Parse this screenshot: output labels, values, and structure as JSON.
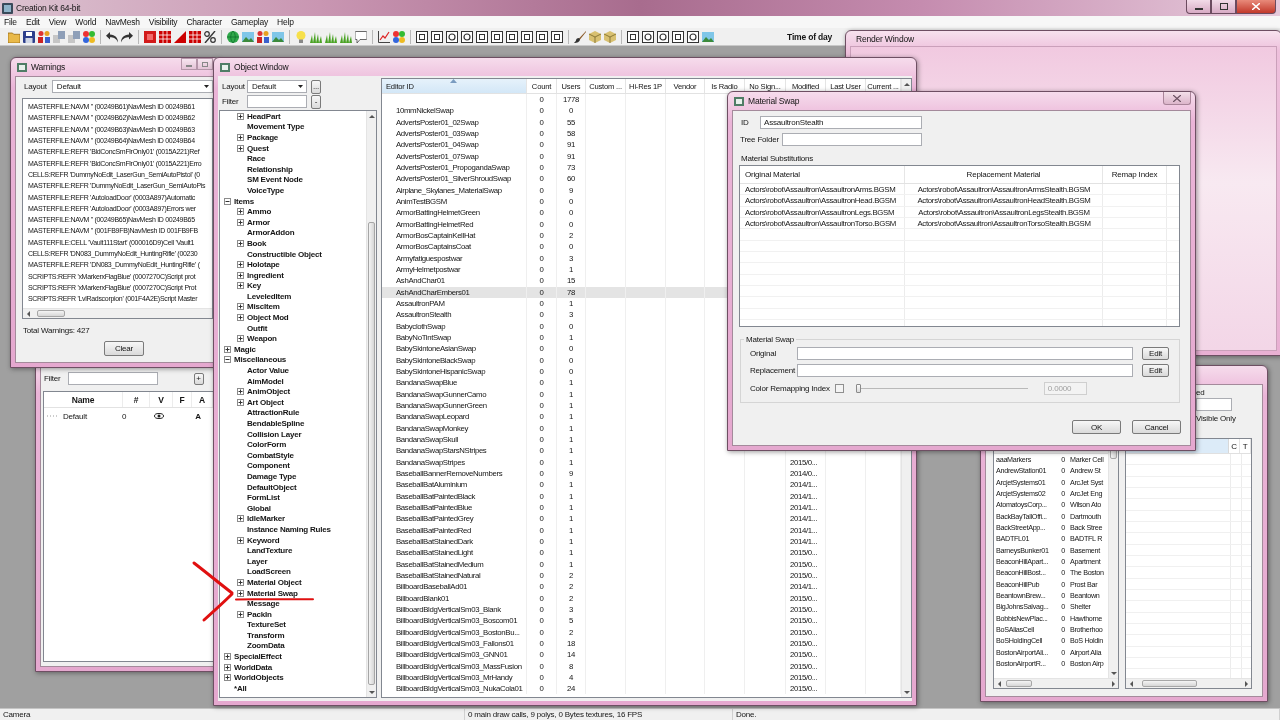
{
  "app": {
    "title": "Creation Kit 64-bit"
  },
  "menu": [
    "File",
    "Edit",
    "View",
    "World",
    "NavMesh",
    "Visibility",
    "Character",
    "Gameplay",
    "Help"
  ],
  "toolbar": {
    "time_of_day_label": "Time of day"
  },
  "render_window": {
    "title": "Render Window"
  },
  "warnings_window": {
    "title": "Warnings",
    "layout_label": "Layout",
    "layout_value": "Default",
    "lines": [
      "MASTERFILE:NAVM '' (00249B61)NavMesh ID 00249B61",
      "MASTERFILE:NAVM '' (00249B62)NavMesh ID 00249B62",
      "MASTERFILE:NAVM '' (00249B63)NavMesh ID 00249B63",
      "MASTERFILE:NAVM '' (00249B64)NavMesh ID 00249B64",
      "MASTERFILE:REFR 'BldConcSmFlrOnly01' (0015A221)Ref",
      "MASTERFILE:REFR 'BldConcSmFlrOnly01' (0015A221)Erro",
      "CELLS:REFR 'DummyNoEdit_LaserGun_SemiAutoPistol' (0",
      "MASTERFILE:REFR 'DummyNoEdit_LaserGun_SemiAutoPis",
      "MASTERFILE:REFR 'AutoloadDoor' (0003A897)Automatic",
      "MASTERFILE:REFR 'AutoloadDoor' (0003A897)Errors wer",
      "MASTERFILE:NAVM '' (00249B65)NavMesh ID 00249B65",
      "MASTERFILE:NAVM '' (001FB9FB)NavMesh ID 001FB9FB",
      "MASTERFILE:CELL 'Vault111Start' (000016D9)Cell 'Vault1",
      "CELLS:REFR 'DN083_DummyNoEdit_HuntingRifle' (00230",
      "MASTERFILE:REFR 'DN083_DummyNoEdit_HuntingRifle' (",
      "SCRIPTS:REFR 'xMarkerxFlagBlue' (0007270C)Script prot",
      "SCRIPTS:REFR 'xMarkerxFlagBlue' (0007270C)Script Prot",
      "SCRIPTS:REFR 'LvlRadscorpion' (001F4A2E)Script Master"
    ],
    "total": "Total Warnings: 427",
    "clear_button": "Clear"
  },
  "layer_window": {
    "filter_label": "Filter",
    "add_button": "+",
    "columns": [
      "Name",
      "#",
      "V",
      "F",
      "A"
    ],
    "rows": [
      {
        "name": "Default",
        "count": "0",
        "visible": true,
        "active_flag": "A"
      }
    ]
  },
  "object_window": {
    "title": "Object Window",
    "layout_label": "Layout",
    "layout_value": "Default",
    "layout_more_button": "...",
    "filter_label": "Filter",
    "filter_button": "-",
    "tree": [
      {
        "children": [
          {
            "label": "HeadPart",
            "expanded": false
          },
          {
            "label": "Movement Type"
          },
          {
            "label": "Package",
            "expanded": false
          },
          {
            "label": "Quest",
            "expanded": false
          },
          {
            "label": "Race"
          },
          {
            "label": "Relationship"
          },
          {
            "label": "SM Event Node"
          },
          {
            "label": "VoiceType"
          }
        ]
      },
      {
        "label": "Items",
        "expanded": true,
        "children": [
          {
            "label": "Ammo",
            "expanded": false
          },
          {
            "label": "Armor",
            "expanded": false
          },
          {
            "label": "ArmorAddon"
          },
          {
            "label": "Book",
            "expanded": false
          },
          {
            "label": "Constructible Object"
          },
          {
            "label": "Holotape",
            "expanded": false
          },
          {
            "label": "Ingredient",
            "expanded": false
          },
          {
            "label": "Key",
            "expanded": false
          },
          {
            "label": "LeveledItem"
          },
          {
            "label": "MiscItem",
            "expanded": false
          },
          {
            "label": "Object Mod",
            "expanded": false
          },
          {
            "label": "Outfit"
          },
          {
            "label": "Weapon",
            "expanded": false
          }
        ]
      },
      {
        "label": "Magic",
        "expanded": false
      },
      {
        "label": "Miscellaneous",
        "expanded": true,
        "children": [
          {
            "label": "Actor Value"
          },
          {
            "label": "AimModel"
          },
          {
            "label": "AnimObject",
            "expanded": false
          },
          {
            "label": "Art Object",
            "expanded": false
          },
          {
            "label": "AttractionRule"
          },
          {
            "label": "BendableSpline"
          },
          {
            "label": "Collision Layer"
          },
          {
            "label": "ColorForm"
          },
          {
            "label": "CombatStyle"
          },
          {
            "label": "Component"
          },
          {
            "label": "Damage Type"
          },
          {
            "label": "DefaultObject"
          },
          {
            "label": "FormList"
          },
          {
            "label": "Global"
          },
          {
            "label": "IdleMarker",
            "expanded": false
          },
          {
            "label": "Instance Naming Rules"
          },
          {
            "label": "Keyword",
            "expanded": false
          },
          {
            "label": "LandTexture"
          },
          {
            "label": "Layer"
          },
          {
            "label": "LoadScreen"
          },
          {
            "label": "Material Object",
            "expanded": false
          },
          {
            "label": "Material Swap",
            "expanded": false
          },
          {
            "label": "Message"
          },
          {
            "label": "PackIn",
            "expanded": false
          },
          {
            "label": "TextureSet"
          },
          {
            "label": "Transform"
          },
          {
            "label": "ZoomData"
          }
        ]
      },
      {
        "label": "SpecialEffect",
        "expanded": false
      },
      {
        "label": "WorldData",
        "expanded": false
      },
      {
        "label": "WorldObjects",
        "expanded": false
      },
      {
        "label": "*All"
      }
    ],
    "columns": [
      "Editor ID",
      "Count",
      "Users",
      "Custom ...",
      "Hi-Res 1P",
      "Vendor",
      "Is Radio",
      "No Sign...",
      "Modified",
      "Last User",
      "Current ..."
    ],
    "rows": [
      {
        "count": "0",
        "users": "1778",
        "selected": false
      },
      {
        "editor_id": "10mmNickelSwap",
        "count": "0",
        "users": "0",
        "selected": false
      },
      {
        "editor_id": "AdvertsPoster01_02Swap",
        "count": "0",
        "users": "55",
        "selected": false
      },
      {
        "editor_id": "AdvertsPoster01_03Swap",
        "count": "0",
        "users": "58",
        "selected": false
      },
      {
        "editor_id": "AdvertsPoster01_04Swap",
        "count": "0",
        "users": "91",
        "selected": false
      },
      {
        "editor_id": "AdvertsPoster01_07Swap",
        "count": "0",
        "users": "91",
        "selected": false
      },
      {
        "editor_id": "AdvertsPoster01_PropogandaSwap",
        "count": "0",
        "users": "73",
        "selected": false
      },
      {
        "editor_id": "AdvertsPoster01_SilverShroudSwap",
        "count": "0",
        "users": "60",
        "selected": false
      },
      {
        "editor_id": "Airplane_Skylanes_MaterialSwap",
        "count": "0",
        "users": "9",
        "selected": false
      },
      {
        "editor_id": "AnimTestBGSM",
        "count": "0",
        "users": "0",
        "selected": false
      },
      {
        "editor_id": "ArmorBattingHelmetGreen",
        "count": "0",
        "users": "0",
        "selected": false
      },
      {
        "editor_id": "ArmorBattingHelmetRed",
        "count": "0",
        "users": "0",
        "selected": false
      },
      {
        "editor_id": "ArmorBosCaptainKellHat",
        "count": "0",
        "users": "2",
        "selected": false
      },
      {
        "editor_id": "ArmorBosCaptainsCoat",
        "count": "0",
        "users": "0",
        "selected": false
      },
      {
        "editor_id": "Armyfatiguespostwar",
        "count": "0",
        "users": "3",
        "selected": false
      },
      {
        "editor_id": "ArmyHelmetpostwar",
        "count": "0",
        "users": "1",
        "selected": false
      },
      {
        "editor_id": "AshAndChar01",
        "count": "0",
        "users": "15",
        "selected": false
      },
      {
        "editor_id": "AshAndCharEmbers01",
        "count": "0",
        "users": "78",
        "selected": true
      },
      {
        "editor_id": "AssaultronPAM",
        "count": "0",
        "users": "1",
        "selected": false
      },
      {
        "editor_id": "AssaultronStealth",
        "count": "0",
        "users": "3",
        "selected": false
      },
      {
        "editor_id": "BabyclothSwap",
        "count": "0",
        "users": "0",
        "selected": false
      },
      {
        "editor_id": "BabyNoTintSwap",
        "count": "0",
        "users": "1",
        "selected": false
      },
      {
        "editor_id": "BabySkintoneAsianSwap",
        "count": "0",
        "users": "0",
        "selected": false
      },
      {
        "editor_id": "BabySkintoneBlackSwap",
        "count": "0",
        "users": "0",
        "selected": false
      },
      {
        "editor_id": "BabySkintoneHispanicSwap",
        "count": "0",
        "users": "0",
        "selected": false
      },
      {
        "editor_id": "BandanaSwapBlue",
        "count": "0",
        "users": "1",
        "selected": false
      },
      {
        "editor_id": "BandanaSwapGunnerCamo",
        "count": "0",
        "users": "1",
        "selected": false
      },
      {
        "editor_id": "BandanaSwapGunnerGreen",
        "count": "0",
        "users": "1",
        "selected": false
      },
      {
        "editor_id": "BandanaSwapLeopard",
        "count": "0",
        "users": "1",
        "selected": false
      },
      {
        "editor_id": "BandanaSwapMonkey",
        "count": "0",
        "users": "1",
        "selected": false
      },
      {
        "editor_id": "BandanaSwapSkull",
        "count": "0",
        "users": "1",
        "selected": false
      },
      {
        "editor_id": "BandanaSwapStarsNStripes",
        "count": "0",
        "users": "1",
        "selected": false
      },
      {
        "editor_id": "BandanaSwapStripes",
        "count": "0",
        "users": "1",
        "modified": "2015/0...",
        "selected": false
      },
      {
        "editor_id": "BaseballBannerRemoveNumbers",
        "count": "0",
        "users": "9",
        "modified": "2014/0...",
        "selected": false
      },
      {
        "editor_id": "BaseballBatAluminium",
        "count": "0",
        "users": "1",
        "modified": "2014/1...",
        "selected": false
      },
      {
        "editor_id": "BaseballBatPaintedBlack",
        "count": "0",
        "users": "1",
        "modified": "2014/1...",
        "selected": false
      },
      {
        "editor_id": "BaseballBatPaintedBlue",
        "count": "0",
        "users": "1",
        "modified": "2014/1...",
        "selected": false
      },
      {
        "editor_id": "BaseballBatPaintedGrey",
        "count": "0",
        "users": "1",
        "modified": "2014/1...",
        "selected": false
      },
      {
        "editor_id": "BaseballBatPaintedRed",
        "count": "0",
        "users": "1",
        "modified": "2014/1...",
        "selected": false
      },
      {
        "editor_id": "BaseballBatStainedDark",
        "count": "0",
        "users": "1",
        "modified": "2014/1...",
        "selected": false
      },
      {
        "editor_id": "BaseballBatStainedLight",
        "count": "0",
        "users": "1",
        "modified": "2015/0...",
        "selected": false
      },
      {
        "editor_id": "BaseballBatStainedMedium",
        "count": "0",
        "users": "1",
        "modified": "2015/0...",
        "selected": false
      },
      {
        "editor_id": "BaseballBatStainedNatural",
        "count": "0",
        "users": "2",
        "modified": "2015/0...",
        "selected": false
      },
      {
        "editor_id": "BillboardBaseballAd01",
        "count": "0",
        "users": "2",
        "modified": "2014/1...",
        "selected": false
      },
      {
        "editor_id": "BillboardBlank01",
        "count": "0",
        "users": "2",
        "modified": "2015/0...",
        "selected": false
      },
      {
        "editor_id": "BillboardBldgVerticalSm03_Blank",
        "count": "0",
        "users": "3",
        "modified": "2015/0...",
        "selected": false
      },
      {
        "editor_id": "BillboardBldgVerticalSm03_Boscom01",
        "count": "0",
        "users": "5",
        "modified": "2015/0...",
        "selected": false
      },
      {
        "editor_id": "BillboardBldgVerticalSm03_BostonBu...",
        "count": "0",
        "users": "2",
        "modified": "2015/0...",
        "selected": false
      },
      {
        "editor_id": "BillboardBldgVerticalSm03_Fallons01",
        "count": "0",
        "users": "18",
        "modified": "2015/0...",
        "selected": false
      },
      {
        "editor_id": "BillboardBldgVerticalSm03_GNN01",
        "count": "0",
        "users": "14",
        "modified": "2015/0...",
        "selected": false
      },
      {
        "editor_id": "BillboardBldgVerticalSm03_MassFusion",
        "count": "0",
        "users": "8",
        "modified": "2015/0...",
        "selected": false
      },
      {
        "editor_id": "BillboardBldgVerticalSm03_MrHandy",
        "count": "0",
        "users": "4",
        "modified": "2015/0...",
        "selected": false
      },
      {
        "editor_id": "BillboardBldgVerticalSm03_NukaCola01",
        "count": "0",
        "users": "24",
        "modified": "2015/0...",
        "selected": false
      }
    ]
  },
  "material_swap_dialog": {
    "title": "Material Swap",
    "id_label": "ID",
    "id_value": "AssaultronStealth",
    "tree_folder_label": "Tree Folder",
    "substitutions_label": "Material Substitutions",
    "columns": [
      "Original Material",
      "Replacement Material",
      "Remap Index"
    ],
    "rows": [
      {
        "original": "Actors\\robot\\Assaultron\\AssaultronArms.BGSM",
        "replacement": "Actors\\robot\\Assaultron\\AssaultronArmsStealth.BGSM"
      },
      {
        "original": "Actors\\robot\\Assaultron\\AssaultronHead.BGSM",
        "replacement": "Actors\\robot\\Assaultron\\AssaultronHeadStealth.BGSM"
      },
      {
        "original": "Actors\\robot\\Assaultron\\AssaultronLegs.BGSM",
        "replacement": "Actors\\robot\\Assaultron\\AssaultronLegsStealth.BGSM"
      },
      {
        "original": "Actors\\robot\\Assaultron\\AssaultronTorso.BGSM",
        "replacement": "Actors\\robot\\Assaultron\\AssaultronTorsoStealth.BGSM"
      }
    ],
    "group_label": "Material Swap",
    "original_label": "Original",
    "replacement_label": "Replacement",
    "edit_buttons": [
      "Edit",
      "Edit"
    ],
    "color_remapping": {
      "label": "Color Remapping Index",
      "checked": false,
      "level": 0,
      "value": "0.0000",
      "disabled": true
    },
    "buttons": [
      "OK",
      "Cancel"
    ]
  },
  "cell_window": {
    "label_fragment": "ed",
    "visible_only_label": "Visible Only",
    "left_rows": [
      {
        "editor_id": "aaaMarkers",
        "count": "0",
        "name": "Marker Cell"
      },
      {
        "editor_id": "AndrewStation01",
        "count": "0",
        "name": "Andrew St"
      },
      {
        "editor_id": "ArcjetSystems01",
        "count": "0",
        "name": "ArcJet Syst"
      },
      {
        "editor_id": "ArcjetSystems02",
        "count": "0",
        "name": "ArcJet Eng"
      },
      {
        "editor_id": "AtomatoysCorp...",
        "count": "0",
        "name": "Wilson Ato"
      },
      {
        "editor_id": "BackBayTallOffi...",
        "count": "0",
        "name": "Dartmouth"
      },
      {
        "editor_id": "BackStreetApp...",
        "count": "0",
        "name": "Back Stree"
      },
      {
        "editor_id": "BADTFL01",
        "count": "0",
        "name": "BADTFL R"
      },
      {
        "editor_id": "BarneysBunker01",
        "count": "0",
        "name": "Basement"
      },
      {
        "editor_id": "BeaconHillApart...",
        "count": "0",
        "name": "Apartment"
      },
      {
        "editor_id": "BeaconHillBost...",
        "count": "0",
        "name": "The Boston"
      },
      {
        "editor_id": "BeaconHillPub",
        "count": "0",
        "name": "Prost Bar"
      },
      {
        "editor_id": "BeantownBrew...",
        "count": "0",
        "name": "Beantown"
      },
      {
        "editor_id": "BigJohnsSalvag...",
        "count": "0",
        "name": "Shelter"
      },
      {
        "editor_id": "BobbisNewPlac...",
        "count": "0",
        "name": "Hawthorne"
      },
      {
        "editor_id": "BoSAliasCell",
        "count": "0",
        "name": "Brotherhoo"
      },
      {
        "editor_id": "BoSHoldingCell",
        "count": "0",
        "name": "BoS Holdin"
      },
      {
        "editor_id": "BostonAirportAli...",
        "count": "0",
        "name": "Airport Alia"
      },
      {
        "editor_id": "BostonAirportR...",
        "count": "0",
        "name": "Boston Airp"
      }
    ],
    "right_columns": [
      "C",
      "T"
    ]
  },
  "status_bar": {
    "mode": "Camera",
    "stats": "0 main draw calls, 9 polys, 0 Bytes textures, 16 FPS",
    "state": "Done."
  }
}
